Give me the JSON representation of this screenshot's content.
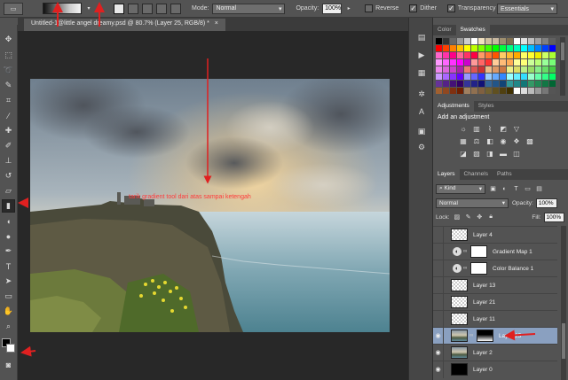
{
  "options_bar": {
    "tool_preset_icon": "gradient-tool-icon",
    "gradient_dropdown": "▾",
    "mode_label": "Mode:",
    "mode_value": "Normal",
    "opacity_label": "Opacity:",
    "opacity_value": "100%",
    "reverse_label": "Reverse",
    "dither_label": "Dither",
    "transparency_label": "Transparency",
    "workspace_value": "Essentials"
  },
  "document_tab": {
    "title": "Untitled-1@little angel dreamy.psd @ 80.7% (Layer 25, RGB/8) *",
    "close": "×"
  },
  "annotation": "tarik gradient tool dari atas sampai ketengah",
  "panels": {
    "color_tabs": [
      "Color",
      "Swatches"
    ],
    "adjustments_tabs": [
      "Adjustments",
      "Styles"
    ],
    "adjustments_title": "Add an adjustment",
    "layers_tabs": [
      "Layers",
      "Channels",
      "Paths"
    ],
    "kind_value": "Kind",
    "blend_value": "Normal",
    "opacity_label": "Opacity:",
    "opacity_value": "100%",
    "lock_label": "Lock:",
    "fill_label": "Fill:",
    "fill_value": "100%"
  },
  "layers": [
    {
      "name": "Layer 4",
      "visible": false,
      "type": "transparent"
    },
    {
      "name": "Gradient Map 1",
      "visible": false,
      "type": "adjustment"
    },
    {
      "name": "Color Balance 1",
      "visible": false,
      "type": "adjustment"
    },
    {
      "name": "Layer 13",
      "visible": false,
      "type": "transparent"
    },
    {
      "name": "Layer 21",
      "visible": false,
      "type": "transparent"
    },
    {
      "name": "Layer 11",
      "visible": false,
      "type": "transparent"
    },
    {
      "name": "Layer 25",
      "visible": true,
      "type": "photo-mask",
      "selected": true
    },
    {
      "name": "Layer 2",
      "visible": true,
      "type": "photo"
    },
    {
      "name": "Layer 0",
      "visible": true,
      "type": "black"
    }
  ],
  "colors": {
    "accent_arrow": "#e02020",
    "selected_layer": "#8aa0c0"
  }
}
